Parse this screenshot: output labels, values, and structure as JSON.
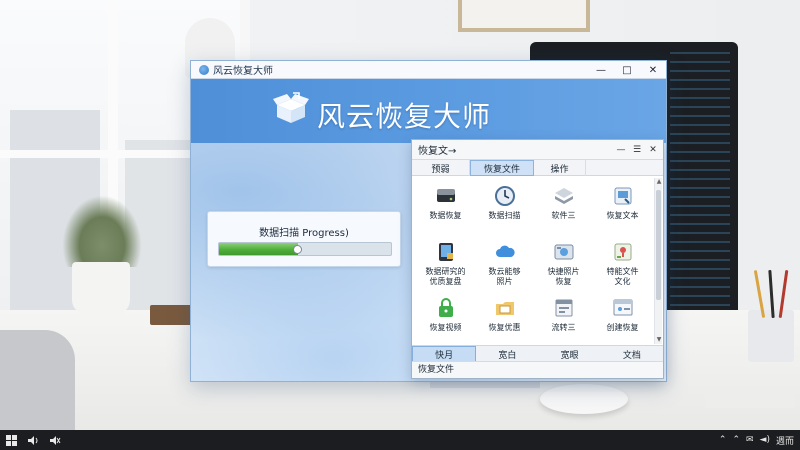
{
  "app": {
    "title": "风云恢复大师",
    "banner_title": "风云恢复大师",
    "window_controls": [
      "—",
      "□",
      "✕"
    ]
  },
  "progress": {
    "label": "数据扫描 Progress)",
    "fraction": 0.46
  },
  "recovery": {
    "title": "恢复文→",
    "window_controls": [
      "—",
      "☰",
      "✕"
    ],
    "tabs": [
      {
        "label": "预弱",
        "active": false
      },
      {
        "label": "恢复文件",
        "active": true
      },
      {
        "label": "操作",
        "active": false
      }
    ],
    "grid": [
      {
        "label": "数据恢复",
        "icon": "disk-icon"
      },
      {
        "label": "数据扫描",
        "icon": "clock-icon"
      },
      {
        "label": "软件三",
        "icon": "layers-icon"
      },
      {
        "label": "恢复文本",
        "icon": "document-icon"
      },
      {
        "label": "数据研究的\n优质复盘",
        "icon": "tablet-icon"
      },
      {
        "label": "数云能够\n照片",
        "icon": "cloud-icon"
      },
      {
        "label": "快捷照片\n恢复",
        "icon": "camera-icon"
      },
      {
        "label": "特能文件\n文化",
        "icon": "map-icon"
      },
      {
        "label": "恢复视频",
        "icon": "lock-icon"
      },
      {
        "label": "恢复优惠",
        "icon": "folder-icon"
      },
      {
        "label": "流转三",
        "icon": "window-icon"
      },
      {
        "label": "创建恢复",
        "icon": "browser-icon"
      }
    ],
    "bottom_tabs": [
      {
        "label": "快月",
        "active": true
      },
      {
        "label": "宽白",
        "active": false
      },
      {
        "label": "宽眼",
        "active": false
      },
      {
        "label": "文档",
        "active": false
      }
    ],
    "status": "恢复文件"
  },
  "taskbar": {
    "left_icons": [
      "windows-icon",
      "speaker-icon",
      "speaker-muted-icon"
    ],
    "right_text": "週而",
    "right_icons": [
      "chevron-up-icon",
      "chevron-up-icon",
      "message-icon",
      "volume-icon"
    ]
  },
  "colors": {
    "banner": "#5a9ae0",
    "progress_fill": "#4fae3b",
    "tab_active": "#cfe1f6"
  }
}
